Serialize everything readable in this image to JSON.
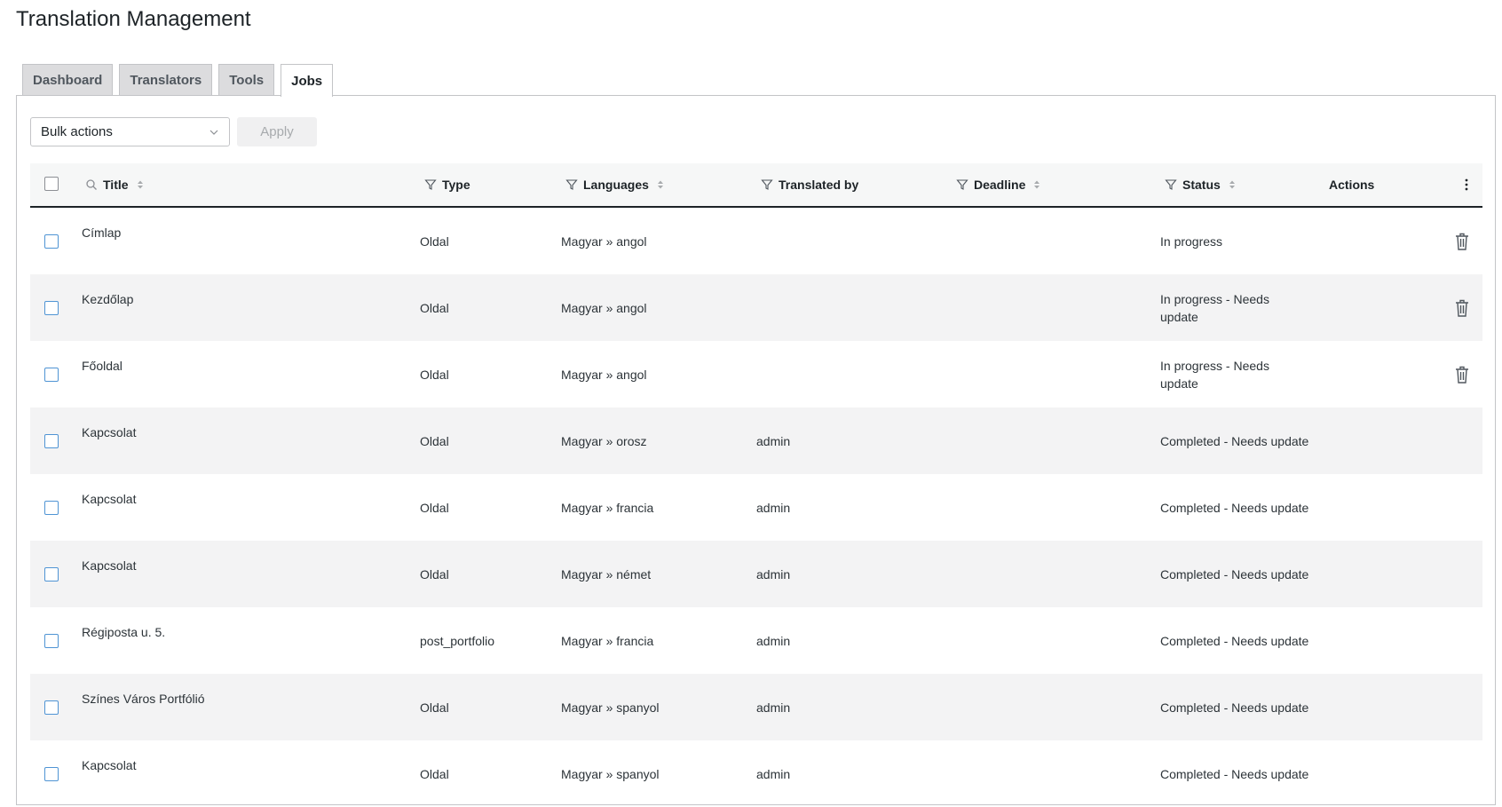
{
  "page": {
    "title": "Translation Management"
  },
  "tabs": [
    {
      "label": "Dashboard",
      "active": false
    },
    {
      "label": "Translators",
      "active": false
    },
    {
      "label": "Tools",
      "active": false
    },
    {
      "label": "Jobs",
      "active": true
    }
  ],
  "bulk": {
    "select_value": "Bulk actions",
    "apply_label": "Apply"
  },
  "columns": {
    "title": "Title",
    "type": "Type",
    "languages": "Languages",
    "translated_by": "Translated by",
    "deadline": "Deadline",
    "status": "Status",
    "actions": "Actions"
  },
  "rows": [
    {
      "title": "Címlap",
      "type": "Oldal",
      "languages": "Magyar » angol",
      "translated_by": "",
      "deadline": "",
      "status": "In progress",
      "has_delete": true
    },
    {
      "title": "Kezdőlap",
      "type": "Oldal",
      "languages": "Magyar » angol",
      "translated_by": "",
      "deadline": "",
      "status": "In progress - Needs update",
      "has_delete": true
    },
    {
      "title": "Főoldal",
      "type": "Oldal",
      "languages": "Magyar » angol",
      "translated_by": "",
      "deadline": "",
      "status": "In progress - Needs update",
      "has_delete": true
    },
    {
      "title": "Kapcsolat",
      "type": "Oldal",
      "languages": "Magyar » orosz",
      "translated_by": "admin",
      "deadline": "",
      "status": "Completed - Needs update",
      "has_delete": false
    },
    {
      "title": "Kapcsolat",
      "type": "Oldal",
      "languages": "Magyar » francia",
      "translated_by": "admin",
      "deadline": "",
      "status": "Completed - Needs update",
      "has_delete": false
    },
    {
      "title": "Kapcsolat",
      "type": "Oldal",
      "languages": "Magyar » német",
      "translated_by": "admin",
      "deadline": "",
      "status": "Completed - Needs update",
      "has_delete": false
    },
    {
      "title": "Régiposta u. 5.",
      "type": "post_portfolio",
      "languages": "Magyar » francia",
      "translated_by": "admin",
      "deadline": "",
      "status": "Completed - Needs update",
      "has_delete": false
    },
    {
      "title": "Színes Város Portfólió",
      "type": "Oldal",
      "languages": "Magyar » spanyol",
      "translated_by": "admin",
      "deadline": "",
      "status": "Completed - Needs update",
      "has_delete": false
    },
    {
      "title": "Kapcsolat",
      "type": "Oldal",
      "languages": "Magyar » spanyol",
      "translated_by": "admin",
      "deadline": "",
      "status": "Completed - Needs update",
      "has_delete": false
    }
  ],
  "icons": {
    "search": "search-icon",
    "sort": "sort-icon",
    "filter": "filter-icon",
    "more": "more-vertical-icon",
    "delete": "trash-icon",
    "dropdown": "chevron-down-icon"
  },
  "colors": {
    "checkbox_border": "#4f94d4",
    "row_alt": "#f3f3f4",
    "header_bg": "#f6f7f7",
    "text": "#1d2327"
  }
}
